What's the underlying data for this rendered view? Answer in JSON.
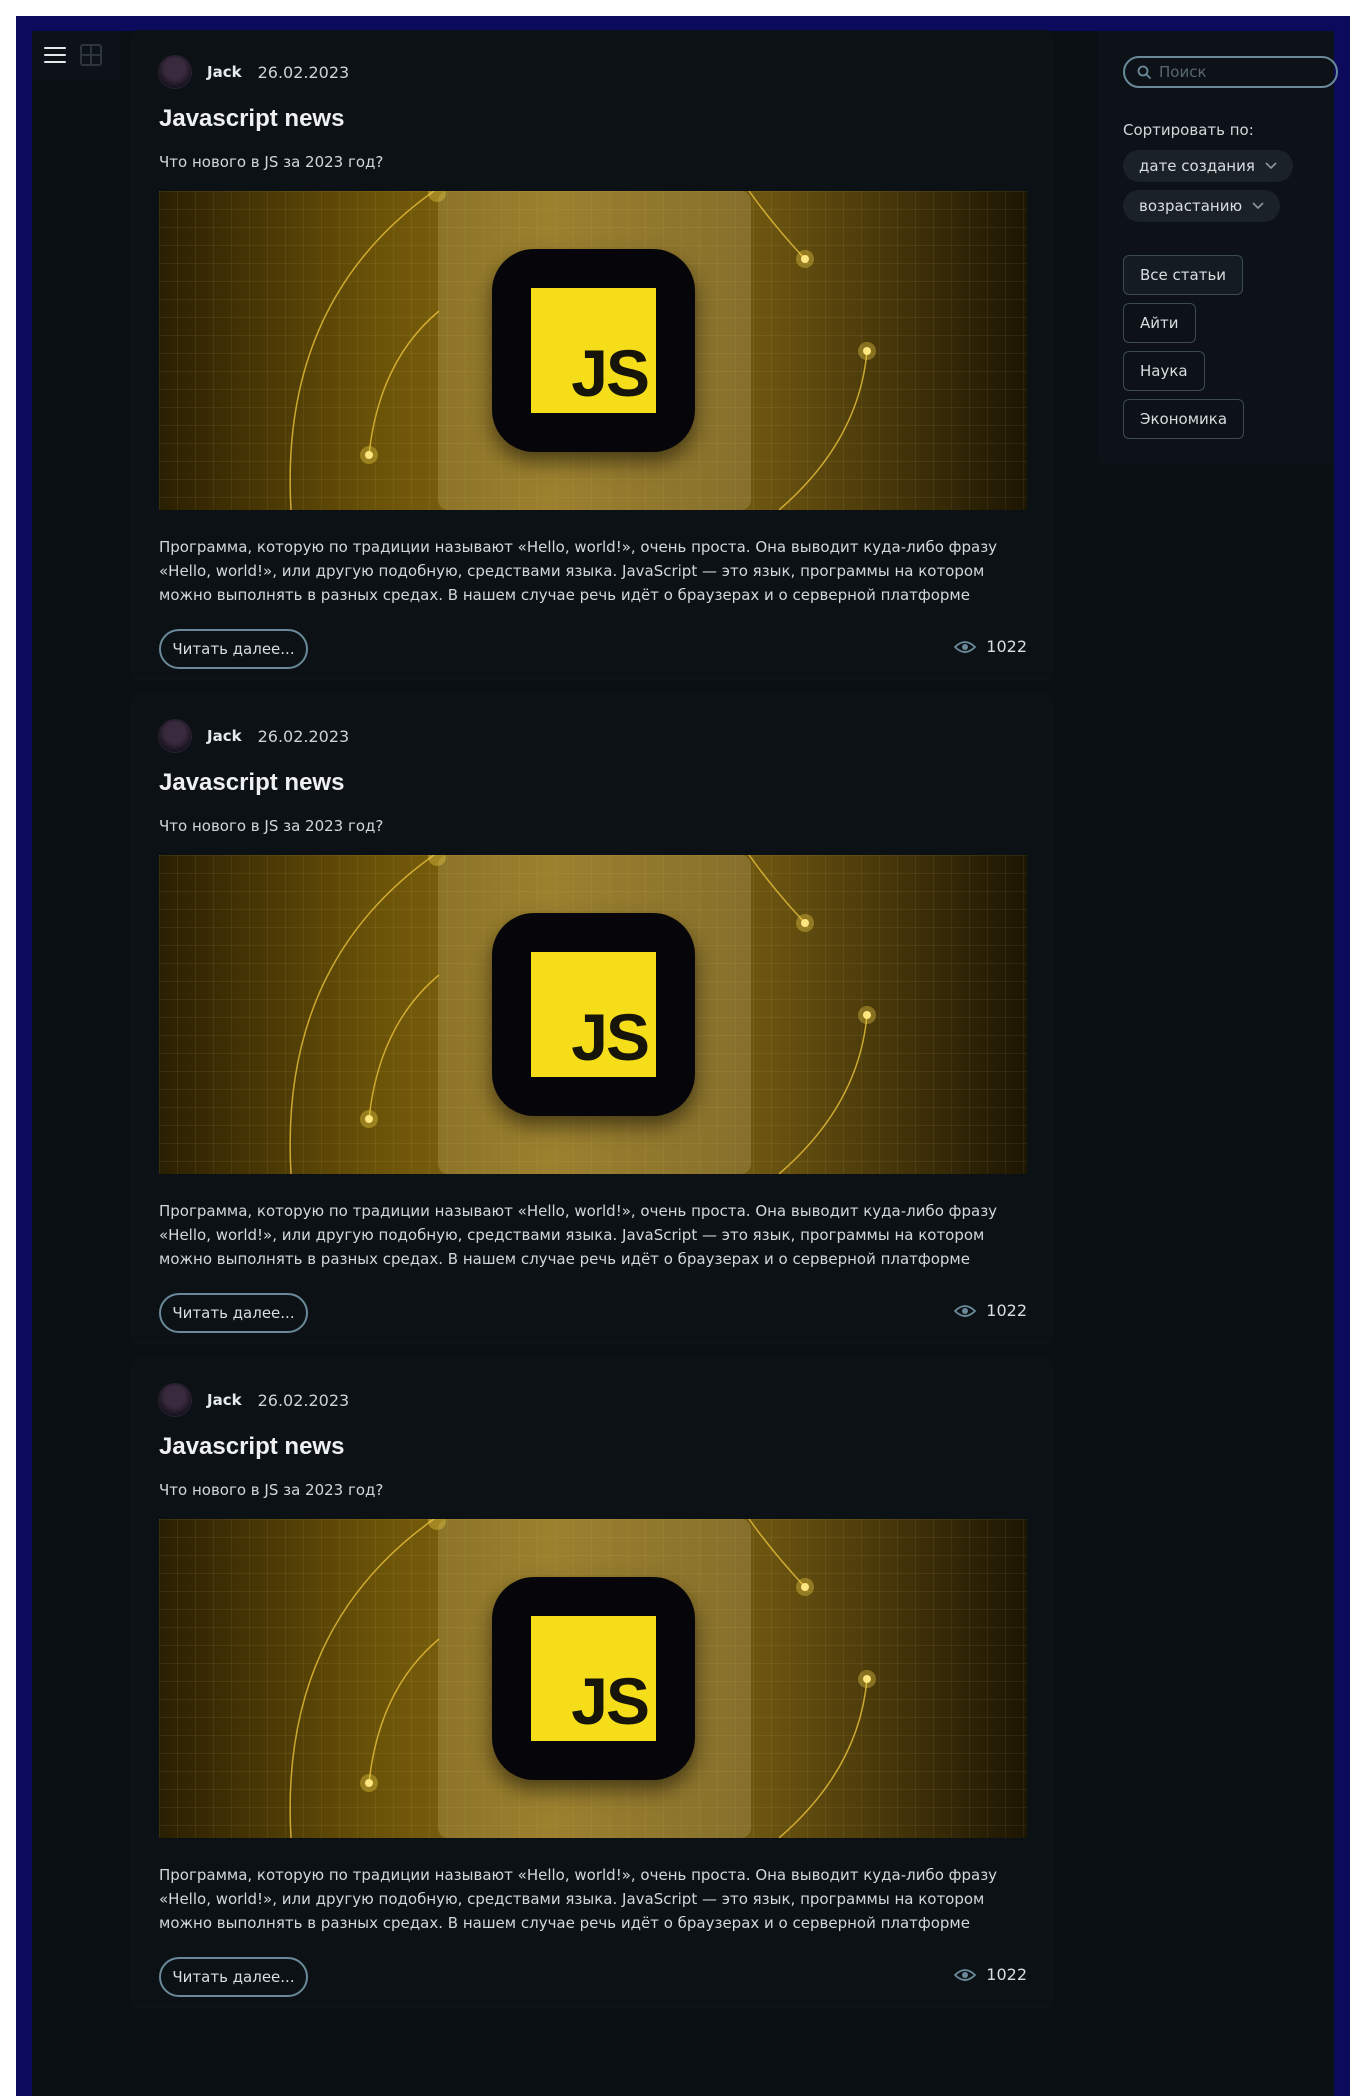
{
  "toolbar": {
    "list_view_icon": "menu-icon",
    "grid_view_icon": "grid-icon"
  },
  "articles": [
    {
      "author": "Jack",
      "date": "26.02.2023",
      "title": "Javascript news",
      "subtitle": "Что нового в JS за 2023 год?",
      "image_label": "JS",
      "excerpt": "Программа, которую по традиции называют «Hello, world!», очень проста. Она выводит куда-либо фразу «Hello, world!», или другую подобную, средствами языка. JavaScript — это язык, программы на котором можно выполнять в разных средах. В нашем случае речь идёт о браузерах и о серверной платформе Node.js. Если до сих пор вы не",
      "read_more": "Читать далее...",
      "views": "1022"
    },
    {
      "author": "Jack",
      "date": "26.02.2023",
      "title": "Javascript news",
      "subtitle": "Что нового в JS за 2023 год?",
      "image_label": "JS",
      "excerpt": "Программа, которую по традиции называют «Hello, world!», очень проста. Она выводит куда-либо фразу «Hello, world!», или другую подобную, средствами языка. JavaScript — это язык, программы на котором можно выполнять в разных средах. В нашем случае речь идёт о браузерах и о серверной платформе Node.js. Если до сих пор вы не",
      "read_more": "Читать далее...",
      "views": "1022"
    },
    {
      "author": "Jack",
      "date": "26.02.2023",
      "title": "Javascript news",
      "subtitle": "Что нового в JS за 2023 год?",
      "image_label": "JS",
      "excerpt": "Программа, которую по традиции называют «Hello, world!», очень проста. Она выводит куда-либо фразу «Hello, world!», или другую подобную, средствами языка. JavaScript — это язык, программы на котором можно выполнять в разных средах. В нашем случае речь идёт о браузерах и о серверной платформе Node.js. Если до сих пор вы не",
      "read_more": "Читать далее...",
      "views": "1022"
    }
  ],
  "sidebar": {
    "search_placeholder": "Поиск",
    "sort_label": "Сортировать по:",
    "sort_field": "дате создания",
    "sort_order": "возрастанию",
    "tags": [
      "Все статьи",
      "Айти",
      "Наука",
      "Экономика"
    ]
  },
  "colors": {
    "accent": "#6a8a99",
    "js_yellow": "#f5de19",
    "frame": "#0b0a5c",
    "background": "#0a1014"
  }
}
